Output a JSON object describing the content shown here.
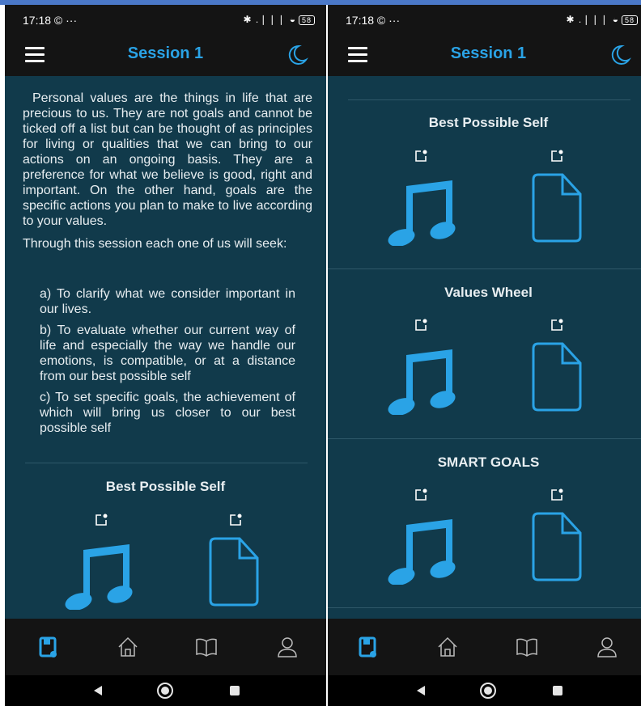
{
  "status": {
    "time": "17:18 © ···",
    "signal": "✱ .❘❘❘ ◒",
    "battery": "58"
  },
  "app": {
    "title": "Session 1"
  },
  "intro_text": "Personal values are the things in life that are precious to us. They are not goals and cannot be ticked off a list but can be thought of as principles for living or qualities that we can bring to our actions on an ongoing basis. They are a preference for what we believe is good, right and important. On the other hand, goals are the specific actions you plan to make to live according to your values.",
  "seek_text": "Through this session each one of us will seek:",
  "objectives": [
    "a) To clarify what we consider important in our lives.",
    "b) To evaluate whether our current way of life and especially the way we handle our emotions, is compatible, or at a distance from our best possible self",
    "c) To set specific goals, the achievement of which will bring us closer to our best possible self"
  ],
  "sections": [
    {
      "title": "Best Possible Self"
    },
    {
      "title": "Values Wheel"
    },
    {
      "title": "SMART GOALS"
    }
  ],
  "nav": [
    "sessions-icon",
    "home-icon",
    "book-icon",
    "profile-icon"
  ],
  "colors": {
    "accent": "#2aa3e6",
    "background": "#113a4b",
    "bar": "#141414"
  }
}
